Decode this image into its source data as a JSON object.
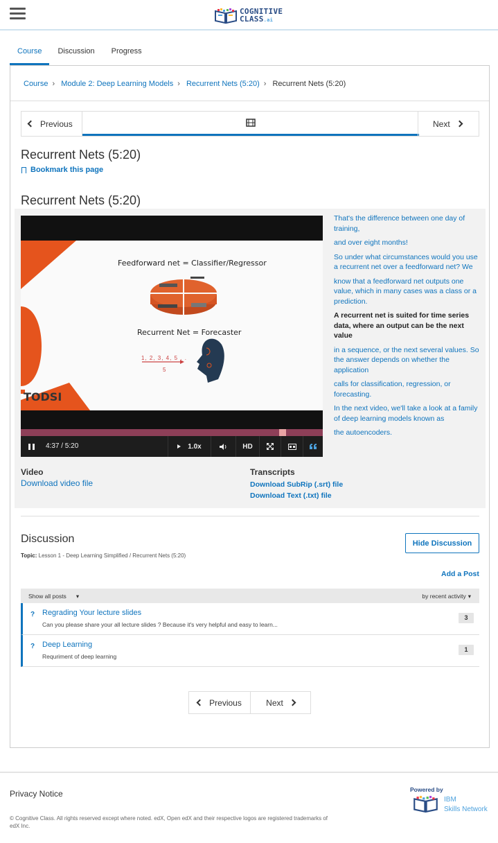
{
  "header": {
    "logo_line1": "COGNITIVE",
    "logo_line2": "CLASS",
    "logo_suffix": ".ai"
  },
  "tabs": [
    {
      "label": "Course",
      "active": true
    },
    {
      "label": "Discussion",
      "active": false
    },
    {
      "label": "Progress",
      "active": false
    }
  ],
  "breadcrumb": {
    "items": [
      "Course",
      "Module 2: Deep Learning Models",
      "Recurrent Nets (5:20)",
      "Recurrent Nets (5:20)"
    ]
  },
  "sequence_nav": {
    "previous_label": "Previous",
    "next_label": "Next",
    "current_icon": "film-icon"
  },
  "unit": {
    "title": "Recurrent Nets (5:20)",
    "bookmark_label": "Bookmark this page",
    "video_title": "Recurrent Nets (5:20)"
  },
  "video": {
    "slide_title_1": "Feedforward net = Classifier/Regressor",
    "slide_title_2": "Recurrent Net = Forecaster",
    "slide_seq": "1, 2, 3, 4, 5 . .",
    "slide_seq2": "5",
    "slide_logo": "TODSI",
    "time": "4:37 / 5:20",
    "progress_fraction": 0.866,
    "speed_label": "1.0x",
    "hd_label": "HD"
  },
  "transcript": [
    {
      "text": "That's the difference between one day of training,",
      "current": false
    },
    {
      "text": "and over eight months!",
      "current": false
    },
    {
      "text": "So under what circumstances would you use a recurrent net over a feedforward net? We",
      "current": false
    },
    {
      "text": "know that a feedforward net outputs one value, which in many cases was a class or a prediction.",
      "current": false
    },
    {
      "text": "A recurrent net is suited for time series data, where an output can be the next value",
      "current": true
    },
    {
      "text": "in a sequence, or the next several values. So the answer depends on whether the application",
      "current": false
    },
    {
      "text": "calls for classification, regression, or forecasting.",
      "current": false
    },
    {
      "text": "In the next video, we'll take a look at a family of deep learning models known as",
      "current": false
    },
    {
      "text": "the autoencoders.",
      "current": false
    }
  ],
  "downloads": {
    "video_heading": "Video",
    "video_link": "Download video file",
    "transcripts_heading": "Transcripts",
    "srt_link": "Download SubRip (.srt) file",
    "txt_link": "Download Text (.txt) file"
  },
  "discussion": {
    "title": "Discussion",
    "topic_label": "Topic:",
    "topic_value": "Lesson 1 - Deep Learning Simplified / Recurrent Nets (5:20)",
    "hide_button": "Hide Discussion",
    "add_post": "Add a Post",
    "filter_left": "Show all posts",
    "filter_right": "by recent activity",
    "posts": [
      {
        "title": "Regrading Your lecture slides",
        "snippet": "Can you please share your all lecture slides ? Because it's very helpful and easy to learn...",
        "count": "3"
      },
      {
        "title": "Deep Learning",
        "snippet": "Requriment of deep learning",
        "count": "1"
      }
    ]
  },
  "bottom_nav": {
    "previous_label": "Previous",
    "next_label": "Next"
  },
  "footer": {
    "privacy": "Privacy Notice",
    "copyright": "© Cognitive Class. All rights reserved except where noted. edX, Open edX and their respective logos are registered trademarks of edX Inc.",
    "powered_by": "Powered by",
    "ibm_line1": "IBM",
    "ibm_line2": "Skills Network"
  },
  "colors": {
    "accent": "#0f74bd",
    "progress_track": "#8e3f58",
    "slide_orange": "#e5541d"
  }
}
